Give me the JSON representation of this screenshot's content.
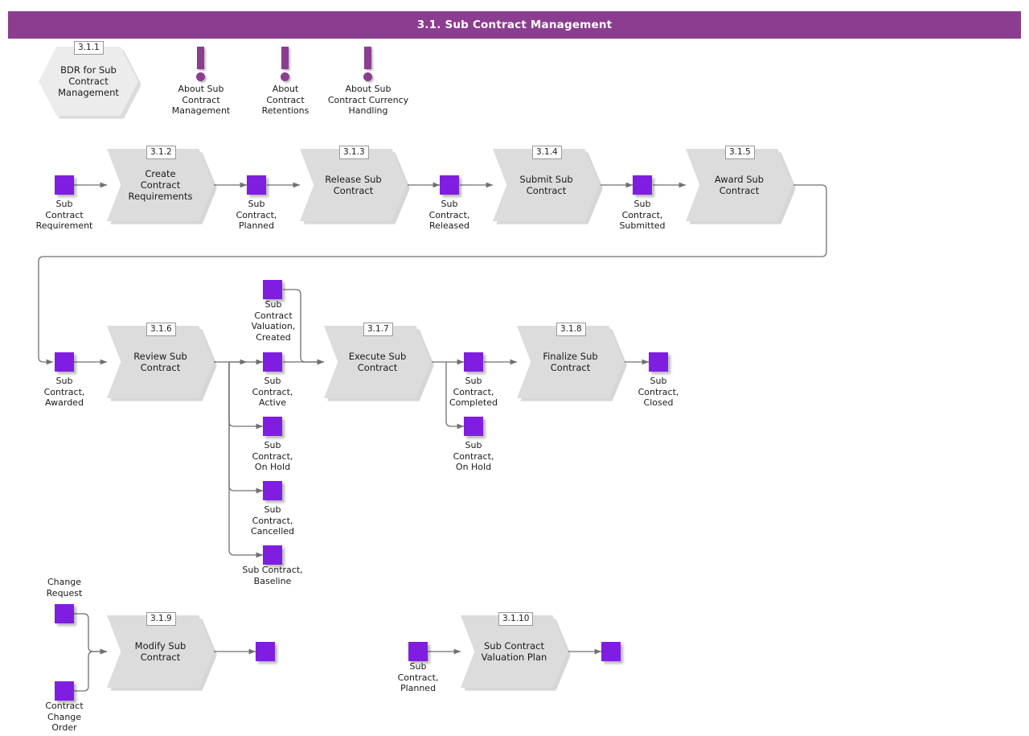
{
  "header": {
    "title": "3.1. Sub Contract Management",
    "bar_color": "#8b3d8f"
  },
  "theme": {
    "state_color": "#7f1ee0",
    "process_fill": "#dcdcdc",
    "hexagon_fill": "#ececec",
    "connector_color": "#707070"
  },
  "hexagon": {
    "id": "3.1.1",
    "label": "BDR for Sub\nContract\nManagement"
  },
  "info_markers": [
    {
      "label": "About Sub\nContract\nManagement"
    },
    {
      "label": "About\nContract\nRetentions"
    },
    {
      "label": "About Sub\nContract Currency\nHandling"
    }
  ],
  "processes": [
    {
      "id": "3.1.2",
      "label": "Create\nContract\nRequirements"
    },
    {
      "id": "3.1.3",
      "label": "Release Sub\nContract"
    },
    {
      "id": "3.1.4",
      "label": "Submit Sub\nContract"
    },
    {
      "id": "3.1.5",
      "label": "Award Sub\nContract"
    },
    {
      "id": "3.1.6",
      "label": "Review Sub\nContract"
    },
    {
      "id": "3.1.7",
      "label": "Execute Sub\nContract"
    },
    {
      "id": "3.1.8",
      "label": "Finalize Sub\nContract"
    },
    {
      "id": "3.1.9",
      "label": "Modify Sub\nContract"
    },
    {
      "id": "3.1.10",
      "label": "Sub Contract\nValuation Plan"
    }
  ],
  "states": {
    "requirement": "Sub\nContract\nRequirement",
    "planned": "Sub\nContract,\nPlanned",
    "released": "Sub\nContract,\nReleased",
    "submitted": "Sub\nContract,\nSubmitted",
    "awarded": "Sub\nContract,\nAwarded",
    "valuation_created": "Sub\nContract\nValuation,\nCreated",
    "active": "Sub\nContract,\nActive",
    "on_hold_review": "Sub\nContract,\nOn Hold",
    "cancelled": "Sub\nContract,\nCancelled",
    "baseline": "Sub Contract,\nBaseline",
    "completed": "Sub\nContract,\nCompleted",
    "on_hold_execute": "Sub\nContract,\nOn Hold",
    "closed": "Sub\nContract,\nClosed",
    "change_request": "Change\nRequest",
    "contract_change_order": "Contract\nChange\nOrder",
    "valuation_planned": "Sub\nContract,\nPlanned"
  }
}
